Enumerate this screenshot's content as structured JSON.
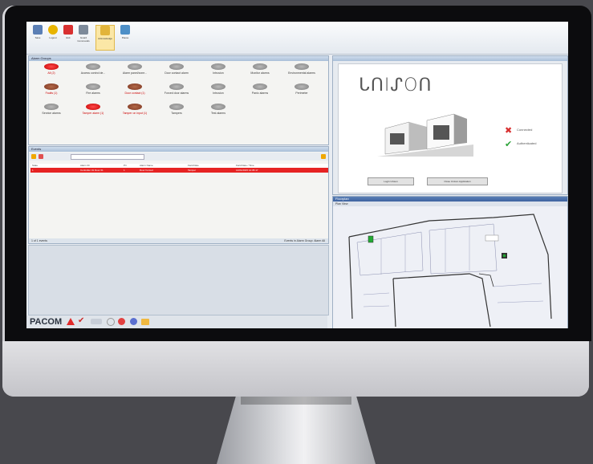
{
  "brand": {
    "pacom": "PACOM"
  },
  "ribbon": {
    "buttons": [
      {
        "label": "Save",
        "icon": "save-icon",
        "color": "#5b7fb5"
      },
      {
        "label": "Logout",
        "icon": "logout-icon",
        "color": "#e8b400"
      },
      {
        "label": "Exit",
        "icon": "exit-icon",
        "color": "#d83030"
      },
      {
        "label": "Guard Commands",
        "icon": "guard-icon",
        "color": "#7d8a9a"
      },
      {
        "label": "Acknowledge",
        "icon": "acknowledge-icon",
        "color": "#e2b43a"
      },
      {
        "label": "Pause",
        "icon": "pause-icon",
        "color": "#4d8fc7"
      }
    ]
  },
  "alarms_panel": {
    "title": "Alarm Groups",
    "items": [
      {
        "label": "All (2)",
        "state": "red"
      },
      {
        "label": "Access control de...",
        "state": "grey"
      },
      {
        "label": "Alarm panel/zone...",
        "state": "grey"
      },
      {
        "label": "Door contact alarm",
        "state": "grey"
      },
      {
        "label": "Intrusion",
        "state": "grey"
      },
      {
        "label": "Monitor alarms",
        "state": "grey"
      },
      {
        "label": "Environmental alarms",
        "state": "grey"
      },
      {
        "label": "Faults (1)",
        "state": "brown"
      },
      {
        "label": "Fire alarms",
        "state": "grey"
      },
      {
        "label": "Door contact (1)",
        "state": "brown"
      },
      {
        "label": "Forced door alarms",
        "state": "grey"
      },
      {
        "label": "Intrusion",
        "state": "grey"
      },
      {
        "label": "Panic alarms",
        "state": "grey"
      },
      {
        "label": "Perimeter",
        "state": "grey"
      },
      {
        "label": "Service alarms",
        "state": "grey"
      },
      {
        "label": "Tamper alarm (1)",
        "state": "red"
      },
      {
        "label": "Tamper on input (1)",
        "state": "brown"
      },
      {
        "label": "Tampers",
        "state": "grey"
      },
      {
        "label": "Test alarms",
        "state": "grey"
      }
    ]
  },
  "events_panel": {
    "title": "Events",
    "columns": [
      "State",
      "Alarm ID",
      "Pri",
      "Alarm Name",
      "Field Date",
      "Field Date / Time"
    ],
    "row": [
      "1",
      "Controller 01 Door 01",
      "1",
      "Door Forced",
      "Tamper",
      "14/01/2015 12:35:17"
    ],
    "status": "1 of 1 events",
    "status_right": "Events in Alarm Group: Alarm All"
  },
  "splash": {
    "logo": "ᒐᑎIᔑOᑎ",
    "status_items": [
      {
        "label": "Connected",
        "icon": "cross-icon",
        "color": "#d83030"
      },
      {
        "label": "Authenticated",
        "icon": "check-icon",
        "color": "#2ea43a"
      }
    ],
    "buttons": [
      "Login Unison",
      "Close Unison Application"
    ]
  },
  "map_panel": {
    "title": "Floorplan",
    "subtitle": "Plan View"
  }
}
